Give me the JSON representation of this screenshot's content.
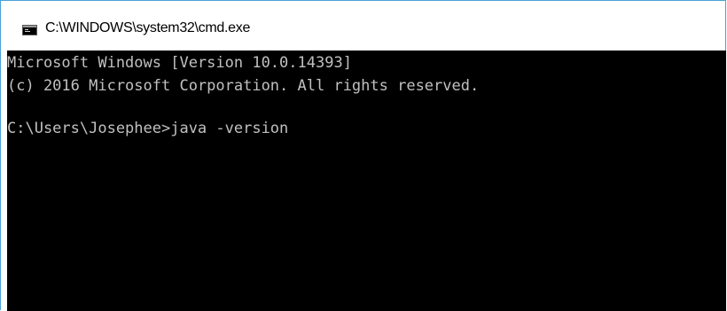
{
  "window": {
    "title": "C:\\WINDOWS\\system32\\cmd.exe",
    "icon": "cmd-console-icon"
  },
  "console": {
    "lines": [
      "Microsoft Windows [Version 10.0.14393]",
      "(c) 2016 Microsoft Corporation. All rights reserved.",
      "",
      "C:\\Users\\Josephee>java -version"
    ],
    "background_color": "#000000",
    "text_color": "#c0c0c0"
  }
}
